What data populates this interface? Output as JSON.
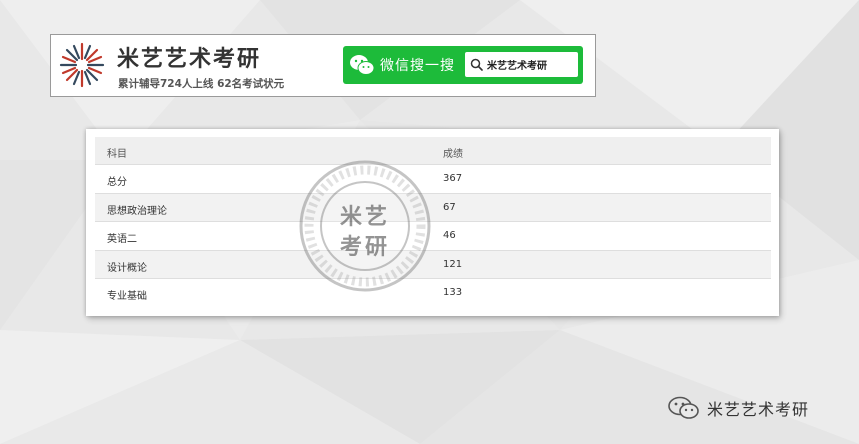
{
  "header": {
    "brand_title": "米艺艺术考研",
    "brand_subtitle": "累计辅导724人上线 62名考试状元",
    "wechat_label": "微信搜一搜",
    "search_value": "米艺艺术考研"
  },
  "table": {
    "headers": [
      "科目",
      "成绩"
    ],
    "rows": [
      {
        "subject": "总分",
        "score": "367"
      },
      {
        "subject": "思想政治理论",
        "score": "67"
      },
      {
        "subject": "英语二",
        "score": "46"
      },
      {
        "subject": "设计概论",
        "score": "121"
      },
      {
        "subject": "专业基础",
        "score": "133"
      }
    ]
  },
  "watermark": {
    "line1": "米艺",
    "line2": "考研"
  },
  "footer": {
    "brand_text": "米艺艺术考研"
  },
  "colors": {
    "wechat_green": "#1dbb3a",
    "logo_red": "#c0392b",
    "logo_navy": "#34495e"
  }
}
